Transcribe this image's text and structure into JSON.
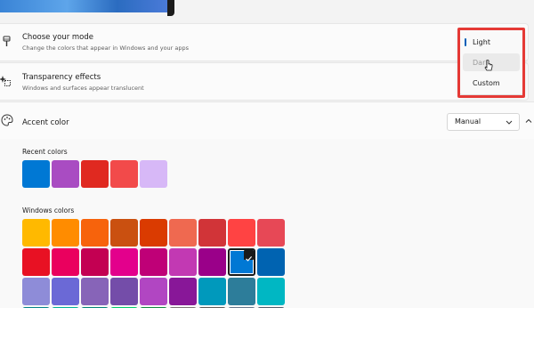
{
  "mode": {
    "title": "Choose your mode",
    "subtitle": "Change the colors that appear in Windows and your apps",
    "icon": "paintbrush-icon",
    "options": [
      "Light",
      "Dark",
      "Custom"
    ],
    "selected": "Light",
    "hovered": "Dark"
  },
  "transparency": {
    "title": "Transparency effects",
    "subtitle": "Windows and surfaces appear translucent",
    "icon": "sparkle-icon"
  },
  "accent": {
    "title": "Accent color",
    "icon": "palette-icon",
    "select_value": "Manual"
  },
  "recent": {
    "label": "Recent colors",
    "colors": [
      "#0078d4",
      "#a94cc2",
      "#e02920",
      "#f24a4a",
      "#d7b8f7"
    ]
  },
  "windows": {
    "label": "Windows colors",
    "selected_index": 16,
    "colors": [
      "#ffb900",
      "#ff8c00",
      "#f7630c",
      "#ca5010",
      "#da3b01",
      "#ef6950",
      "#d13438",
      "#ff4343",
      "#e74856",
      "#e81123",
      "#ea005e",
      "#c30052",
      "#e3008c",
      "#bf0077",
      "#c239b3",
      "#9a0089",
      "#0078d4",
      "#0063b1",
      "#8e8cd8",
      "#6b69d6",
      "#8764b8",
      "#744da9",
      "#b146c2",
      "#881798",
      "#0099bc",
      "#2d7d9a",
      "#00b7c3"
    ]
  },
  "highlight_color": "#e53935",
  "accent_brand": "#005fb8"
}
